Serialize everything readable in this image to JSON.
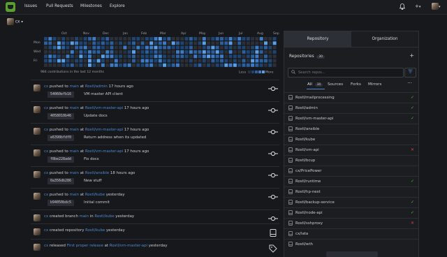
{
  "nav": {
    "items": [
      "Issues",
      "Pull Requests",
      "Milestones",
      "Explore"
    ],
    "bell_icon": "bell-icon",
    "plus_label": "+",
    "caret": "▾"
  },
  "context": {
    "user": "cx",
    "caret": "▾"
  },
  "heatmap": {
    "months": [
      "Oct",
      "Nov",
      "Dec",
      "Jan",
      "Feb",
      "Mar",
      "Apr",
      "May",
      "Jun",
      "Jul",
      "Aug",
      "Sep"
    ],
    "days": [
      "Mon",
      "Wed",
      "Fri"
    ],
    "total": "984 contributions in the last 12 months",
    "less": "Less",
    "more": "More",
    "colors": [
      "#2a2f38",
      "#1e4471",
      "#2b5f9e",
      "#3c7cc6",
      "#5aa0e6"
    ]
  },
  "feed": [
    {
      "actor": "cx",
      "action": "pushed to",
      "branch": "main",
      "at": "at",
      "repo": "Rostl/admin",
      "time": "17 hours ago",
      "sha": "54060efb16",
      "message": "VM master API client",
      "icon": "commit-icon"
    },
    {
      "actor": "cx",
      "action": "pushed to",
      "branch": "main",
      "at": "at",
      "repo": "Rostl/vm-master-api",
      "time": "17 hours ago",
      "sha": "4058010b46",
      "message": "Update docs",
      "icon": "commit-icon"
    },
    {
      "actor": "cx",
      "action": "pushed to",
      "branch": "main",
      "at": "at",
      "repo": "Rostl/vm-master-api",
      "time": "17 hours ago",
      "sha": "e6390bfdf0",
      "message": "Return address when its updated",
      "icon": "commit-icon"
    },
    {
      "actor": "cx",
      "action": "pushed to",
      "branch": "main",
      "at": "at",
      "repo": "Rostl/vm-master-api",
      "time": "17 hours ago",
      "sha": "f8be228add",
      "message": "Fix docs",
      "icon": "commit-icon"
    },
    {
      "actor": "cx",
      "action": "pushed to",
      "branch": "main",
      "at": "at",
      "repo": "Rostl/ansible",
      "time": "18 hours ago",
      "sha": "0a356db286",
      "message": "New stuff",
      "icon": "commit-icon"
    },
    {
      "actor": "cx",
      "action": "pushed to",
      "branch": "main",
      "at": "at",
      "repo": "Rostl/kube",
      "time": "yesterday",
      "sha": "b94050bdc5",
      "message": "Initial commit",
      "icon": "commit-icon"
    },
    {
      "actor": "cx",
      "action": "created branch",
      "branch": "main",
      "at": "in",
      "repo": "Rostl/kube",
      "time": "yesterday",
      "icon": "commit-icon"
    },
    {
      "actor": "cx",
      "action": "created repository",
      "branch": "",
      "at": "",
      "repo": "Rostl/kube",
      "time": "yesterday",
      "icon": "repo-icon"
    },
    {
      "actor": "cx",
      "action": "released",
      "branch": "First proper release",
      "at": "at",
      "repo": "Rostl/vm-master-api",
      "time": "yesterday",
      "icon": "tag-icon"
    }
  ],
  "panel": {
    "tabs": [
      "Repository",
      "Organization"
    ],
    "title": "Repositories",
    "count": "30",
    "plus": "+",
    "search_placeholder": "Search repos...",
    "subtabs": [
      "All",
      "Sources",
      "Forks",
      "Mirrors"
    ],
    "all_count": "30",
    "more": "···",
    "repos": [
      {
        "name": "Rostl/mailprocessing",
        "status": "ok"
      },
      {
        "name": "Rostl/admin",
        "status": "ok"
      },
      {
        "name": "Rostl/vm-master-api",
        "status": "ok"
      },
      {
        "name": "Rostl/ansible",
        "status": ""
      },
      {
        "name": "Rostl/kube",
        "status": ""
      },
      {
        "name": "Rostl/vm-api",
        "status": "fail"
      },
      {
        "name": "Rostl/bcup",
        "status": ""
      },
      {
        "name": "cx/PricePower",
        "status": ""
      },
      {
        "name": "Rostl/runtime",
        "status": "ok"
      },
      {
        "name": "Rostl/hp-next",
        "status": ""
      },
      {
        "name": "Rostl/backup-service",
        "status": "ok"
      },
      {
        "name": "Rostl/node-api",
        "status": "ok"
      },
      {
        "name": "Rostl/sshproxy",
        "status": "fail"
      },
      {
        "name": "cx/lata",
        "status": ""
      },
      {
        "name": "Rostl/wth",
        "status": ""
      }
    ]
  }
}
